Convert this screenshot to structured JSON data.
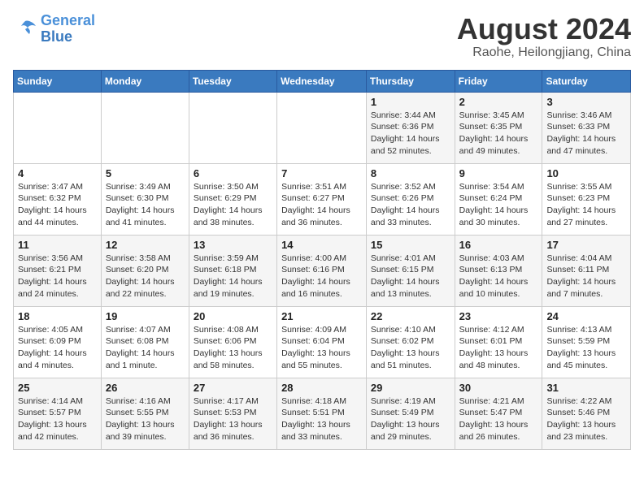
{
  "logo": {
    "line1": "General",
    "line2": "Blue"
  },
  "title": {
    "month_year": "August 2024",
    "location": "Raohe, Heilongjiang, China"
  },
  "days_of_week": [
    "Sunday",
    "Monday",
    "Tuesday",
    "Wednesday",
    "Thursday",
    "Friday",
    "Saturday"
  ],
  "weeks": [
    [
      {
        "day": "",
        "info": ""
      },
      {
        "day": "",
        "info": ""
      },
      {
        "day": "",
        "info": ""
      },
      {
        "day": "",
        "info": ""
      },
      {
        "day": "1",
        "info": "Sunrise: 3:44 AM\nSunset: 6:36 PM\nDaylight: 14 hours\nand 52 minutes."
      },
      {
        "day": "2",
        "info": "Sunrise: 3:45 AM\nSunset: 6:35 PM\nDaylight: 14 hours\nand 49 minutes."
      },
      {
        "day": "3",
        "info": "Sunrise: 3:46 AM\nSunset: 6:33 PM\nDaylight: 14 hours\nand 47 minutes."
      }
    ],
    [
      {
        "day": "4",
        "info": "Sunrise: 3:47 AM\nSunset: 6:32 PM\nDaylight: 14 hours\nand 44 minutes."
      },
      {
        "day": "5",
        "info": "Sunrise: 3:49 AM\nSunset: 6:30 PM\nDaylight: 14 hours\nand 41 minutes."
      },
      {
        "day": "6",
        "info": "Sunrise: 3:50 AM\nSunset: 6:29 PM\nDaylight: 14 hours\nand 38 minutes."
      },
      {
        "day": "7",
        "info": "Sunrise: 3:51 AM\nSunset: 6:27 PM\nDaylight: 14 hours\nand 36 minutes."
      },
      {
        "day": "8",
        "info": "Sunrise: 3:52 AM\nSunset: 6:26 PM\nDaylight: 14 hours\nand 33 minutes."
      },
      {
        "day": "9",
        "info": "Sunrise: 3:54 AM\nSunset: 6:24 PM\nDaylight: 14 hours\nand 30 minutes."
      },
      {
        "day": "10",
        "info": "Sunrise: 3:55 AM\nSunset: 6:23 PM\nDaylight: 14 hours\nand 27 minutes."
      }
    ],
    [
      {
        "day": "11",
        "info": "Sunrise: 3:56 AM\nSunset: 6:21 PM\nDaylight: 14 hours\nand 24 minutes."
      },
      {
        "day": "12",
        "info": "Sunrise: 3:58 AM\nSunset: 6:20 PM\nDaylight: 14 hours\nand 22 minutes."
      },
      {
        "day": "13",
        "info": "Sunrise: 3:59 AM\nSunset: 6:18 PM\nDaylight: 14 hours\nand 19 minutes."
      },
      {
        "day": "14",
        "info": "Sunrise: 4:00 AM\nSunset: 6:16 PM\nDaylight: 14 hours\nand 16 minutes."
      },
      {
        "day": "15",
        "info": "Sunrise: 4:01 AM\nSunset: 6:15 PM\nDaylight: 14 hours\nand 13 minutes."
      },
      {
        "day": "16",
        "info": "Sunrise: 4:03 AM\nSunset: 6:13 PM\nDaylight: 14 hours\nand 10 minutes."
      },
      {
        "day": "17",
        "info": "Sunrise: 4:04 AM\nSunset: 6:11 PM\nDaylight: 14 hours\nand 7 minutes."
      }
    ],
    [
      {
        "day": "18",
        "info": "Sunrise: 4:05 AM\nSunset: 6:09 PM\nDaylight: 14 hours\nand 4 minutes."
      },
      {
        "day": "19",
        "info": "Sunrise: 4:07 AM\nSunset: 6:08 PM\nDaylight: 14 hours\nand 1 minute."
      },
      {
        "day": "20",
        "info": "Sunrise: 4:08 AM\nSunset: 6:06 PM\nDaylight: 13 hours\nand 58 minutes."
      },
      {
        "day": "21",
        "info": "Sunrise: 4:09 AM\nSunset: 6:04 PM\nDaylight: 13 hours\nand 55 minutes."
      },
      {
        "day": "22",
        "info": "Sunrise: 4:10 AM\nSunset: 6:02 PM\nDaylight: 13 hours\nand 51 minutes."
      },
      {
        "day": "23",
        "info": "Sunrise: 4:12 AM\nSunset: 6:01 PM\nDaylight: 13 hours\nand 48 minutes."
      },
      {
        "day": "24",
        "info": "Sunrise: 4:13 AM\nSunset: 5:59 PM\nDaylight: 13 hours\nand 45 minutes."
      }
    ],
    [
      {
        "day": "25",
        "info": "Sunrise: 4:14 AM\nSunset: 5:57 PM\nDaylight: 13 hours\nand 42 minutes."
      },
      {
        "day": "26",
        "info": "Sunrise: 4:16 AM\nSunset: 5:55 PM\nDaylight: 13 hours\nand 39 minutes."
      },
      {
        "day": "27",
        "info": "Sunrise: 4:17 AM\nSunset: 5:53 PM\nDaylight: 13 hours\nand 36 minutes."
      },
      {
        "day": "28",
        "info": "Sunrise: 4:18 AM\nSunset: 5:51 PM\nDaylight: 13 hours\nand 33 minutes."
      },
      {
        "day": "29",
        "info": "Sunrise: 4:19 AM\nSunset: 5:49 PM\nDaylight: 13 hours\nand 29 minutes."
      },
      {
        "day": "30",
        "info": "Sunrise: 4:21 AM\nSunset: 5:47 PM\nDaylight: 13 hours\nand 26 minutes."
      },
      {
        "day": "31",
        "info": "Sunrise: 4:22 AM\nSunset: 5:46 PM\nDaylight: 13 hours\nand 23 minutes."
      }
    ]
  ]
}
